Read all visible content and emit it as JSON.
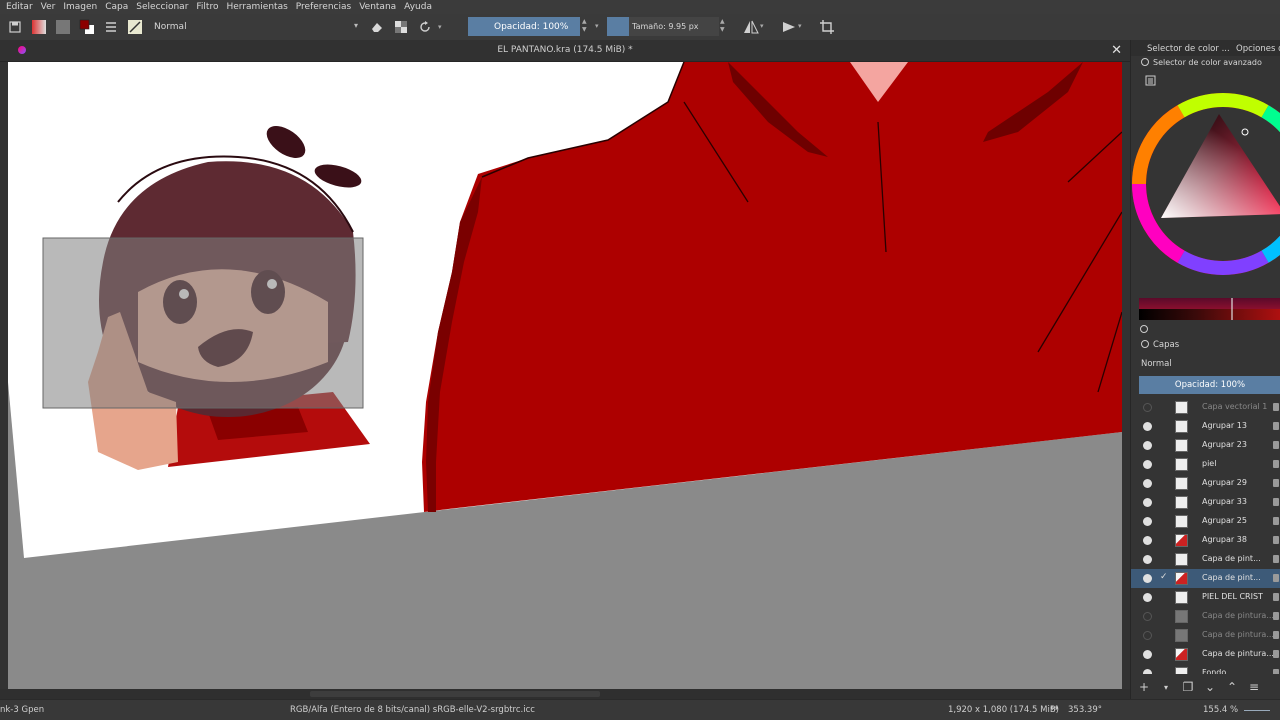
{
  "menu": {
    "items": [
      "Editar",
      "Ver",
      "Imagen",
      "Capa",
      "Seleccionar",
      "Filtro",
      "Herramientas",
      "Preferencias",
      "Ventana",
      "Ayuda"
    ]
  },
  "toolbar": {
    "blend_mode": "Normal",
    "opacity_label": "Opacidad: 100%",
    "size_label": "Tamaño: 9.95 px"
  },
  "document": {
    "title": "EL PANTANO.kra (174.5 MiB) *"
  },
  "docker": {
    "tab_selector": "Selector de color ...",
    "tab_options": "Opciones de",
    "selector_header": "Selector de color avanzado",
    "layers_header": "Capas",
    "layers_blend": "Normal",
    "layers_opacity": "Opacidad:  100%",
    "layers": [
      {
        "name": "Capa vectorial 1",
        "visible": false,
        "dim": true,
        "selected": false,
        "thumb": "white"
      },
      {
        "name": "Agrupar 13",
        "visible": true,
        "dim": false,
        "selected": false,
        "thumb": "white"
      },
      {
        "name": "Agrupar 23",
        "visible": true,
        "dim": false,
        "selected": false,
        "thumb": "white"
      },
      {
        "name": "piel",
        "visible": true,
        "dim": false,
        "selected": false,
        "thumb": "white"
      },
      {
        "name": "Agrupar 29",
        "visible": true,
        "dim": false,
        "selected": false,
        "thumb": "white"
      },
      {
        "name": "Agrupar 33",
        "visible": true,
        "dim": false,
        "selected": false,
        "thumb": "white"
      },
      {
        "name": "Agrupar 25",
        "visible": true,
        "dim": false,
        "selected": false,
        "thumb": "white"
      },
      {
        "name": "Agrupar 38",
        "visible": true,
        "dim": false,
        "selected": false,
        "thumb": "red"
      },
      {
        "name": "Capa de pint...",
        "visible": true,
        "dim": false,
        "selected": false,
        "thumb": "white"
      },
      {
        "name": "Capa de pint...",
        "visible": true,
        "dim": false,
        "selected": true,
        "thumb": "red"
      },
      {
        "name": "PIEL DEL CRIST",
        "visible": true,
        "dim": false,
        "selected": false,
        "thumb": "white"
      },
      {
        "name": "Capa de pintura...",
        "visible": false,
        "dim": true,
        "selected": false,
        "thumb": "gray"
      },
      {
        "name": "Capa de pintura...",
        "visible": false,
        "dim": true,
        "selected": false,
        "thumb": "gray"
      },
      {
        "name": "Capa de pintura...",
        "visible": true,
        "dim": false,
        "selected": false,
        "thumb": "red"
      },
      {
        "name": "Fondo",
        "visible": true,
        "dim": false,
        "selected": false,
        "thumb": "white"
      }
    ]
  },
  "status": {
    "brush": "nk-3 Gpen",
    "color_info": "RGB/Alfa (Entero de 8 bits/canal)  sRGB-elle-V2-srgbtrc.icc",
    "dimensions": "1,920 x 1,080 (174.5 MiB)",
    "rotation": "353.39°",
    "zoom": "155.4 %"
  },
  "colors": {
    "accent": "#5a7ea3",
    "hoodie_red": "#ad0000",
    "canvas_gray": "#8a8a8a"
  },
  "icons": {
    "save": "save-icon",
    "eraser": "eraser-icon",
    "reset": "reset-icon",
    "mirror": "mirror-icon",
    "crop": "crop-icon"
  }
}
